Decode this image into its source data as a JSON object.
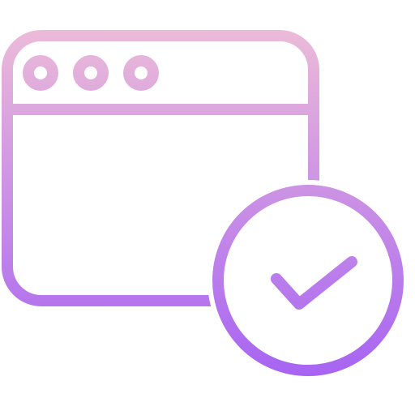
{
  "icon": {
    "name": "browser-window-check-icon",
    "components": [
      "browser-window-icon",
      "window-control-dot-icon",
      "check-circle-icon",
      "checkmark-icon"
    ],
    "gradient": {
      "top_color": "#EDBCD8",
      "bottom_color": "#A461F3"
    }
  }
}
